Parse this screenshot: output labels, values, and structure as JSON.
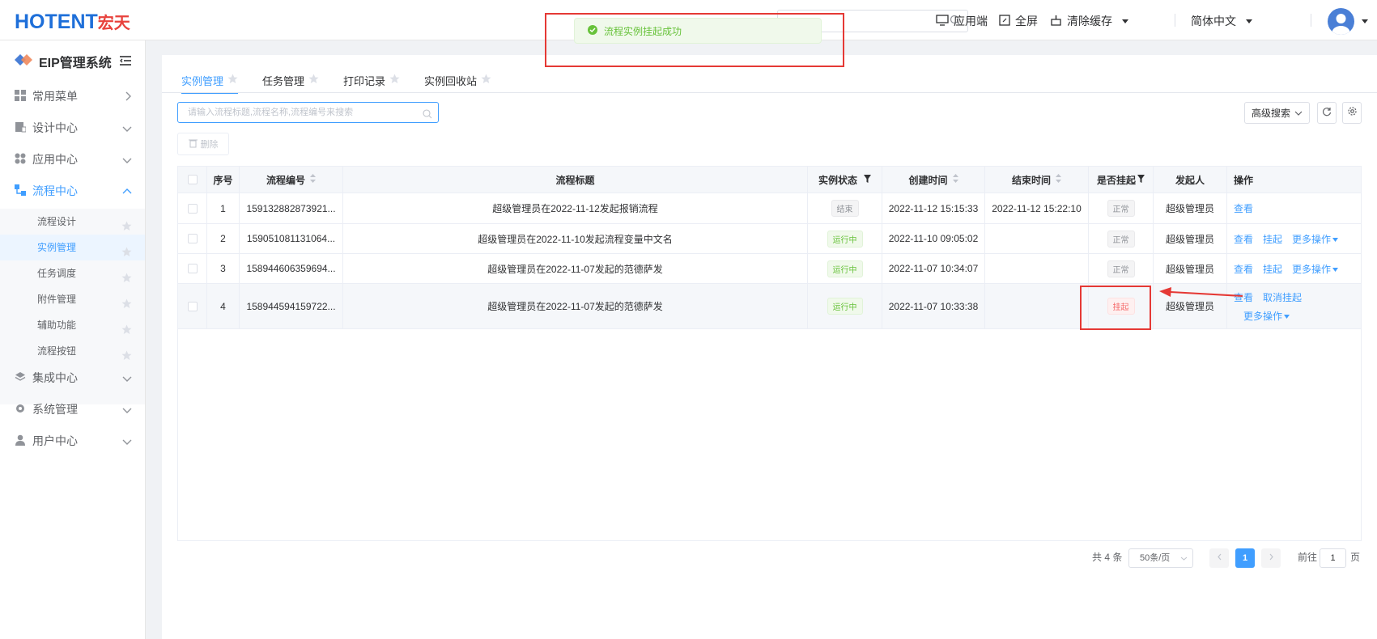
{
  "header": {
    "logo_main": "HOTENT",
    "logo_cn": "宏天",
    "client_label": "应用端",
    "fullscreen_label": "全屏",
    "clear_cache_label": "清除缓存",
    "language_label": "简体中文"
  },
  "toast": {
    "message": "流程实例挂起成功"
  },
  "sidebar": {
    "title": "EIP管理系统",
    "menus": [
      {
        "label": "常用菜单"
      },
      {
        "label": "设计中心"
      },
      {
        "label": "应用中心"
      },
      {
        "label": "流程中心"
      },
      {
        "label": "集成中心"
      },
      {
        "label": "系统管理"
      },
      {
        "label": "用户中心"
      }
    ],
    "sub_items": [
      {
        "label": "流程设计"
      },
      {
        "label": "实例管理"
      },
      {
        "label": "任务调度"
      },
      {
        "label": "附件管理"
      },
      {
        "label": "辅助功能"
      },
      {
        "label": "流程按钮"
      }
    ]
  },
  "tabs": [
    {
      "label": "实例管理"
    },
    {
      "label": "任务管理"
    },
    {
      "label": "打印记录"
    },
    {
      "label": "实例回收站"
    }
  ],
  "toolbar": {
    "search_placeholder": "请输入流程标题,流程名称,流程编号来搜索",
    "delete_label": "删除",
    "advanced_search_label": "高级搜索"
  },
  "table": {
    "columns": [
      "序号",
      "流程编号",
      "流程标题",
      "实例状态",
      "创建时间",
      "结束时间",
      "是否挂起",
      "发起人",
      "操作"
    ],
    "rows": [
      {
        "index": "1",
        "code": "159132882873921...",
        "title": "超级管理员在2022-11-12发起报销流程",
        "status": "结束",
        "created": "2022-11-12 15:15:33",
        "ended": "2022-11-12 15:22:10",
        "suspended": "正常",
        "initiator": "超级管理员",
        "action1": "查看"
      },
      {
        "index": "2",
        "code": "159051081131064...",
        "title": "超级管理员在2022-11-10发起流程变量中文名",
        "status": "运行中",
        "created": "2022-11-10 09:05:02",
        "ended": "",
        "suspended": "正常",
        "initiator": "超级管理员",
        "action1": "查看",
        "action2": "挂起",
        "action3": "更多操作"
      },
      {
        "index": "3",
        "code": "158944606359694...",
        "title": "超级管理员在2022-11-07发起的范德萨发",
        "status": "运行中",
        "created": "2022-11-07 10:34:07",
        "ended": "",
        "suspended": "正常",
        "initiator": "超级管理员",
        "action1": "查看",
        "action2": "挂起",
        "action3": "更多操作"
      },
      {
        "index": "4",
        "code": "158944594159722...",
        "title": "超级管理员在2022-11-07发起的范德萨发",
        "status": "运行中",
        "created": "2022-11-07 10:33:38",
        "ended": "",
        "suspended": "挂起",
        "initiator": "超级管理员",
        "action1": "查看",
        "action2": "取消挂起",
        "action3": "更多操作"
      }
    ]
  },
  "pagination": {
    "total": "共 4 条",
    "page_size": "50条/页",
    "current_page": "1",
    "goto_label": "前往",
    "goto_value": "1",
    "page_unit": "页"
  },
  "colors": {
    "primary": "#409eff",
    "success": "#67c23a",
    "danger": "#f56c6c",
    "annotation": "#e53935"
  }
}
